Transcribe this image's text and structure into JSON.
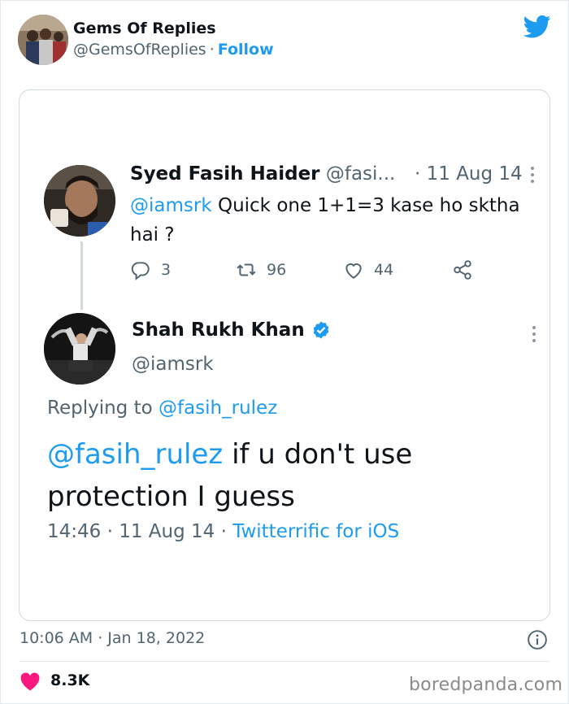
{
  "header": {
    "name": "Gems Of Replies",
    "handle": "@GemsOfReplies",
    "separator": "·",
    "follow_label": "Follow"
  },
  "reply_tweet": {
    "name": "Syed Fasih Haider",
    "handle": "@fasi...",
    "date": "· 11 Aug 14",
    "mention": "@iamsrk",
    "text": " Quick one 1+1=3 kase ho sktha hai ?",
    "replies": "3",
    "retweets": "96",
    "likes": "44"
  },
  "main_tweet": {
    "name": "Shah Rukh Khan",
    "handle": "@iamsrk",
    "replying_prefix": "Replying to ",
    "replying_handle": "@fasih_rulez",
    "mention": "@fasih_rulez",
    "text": " if u don't use protection I guess",
    "time_date": "14:46 · 11 Aug 14 · ",
    "source": "Twitterrific for iOS"
  },
  "footer": {
    "timestamp": "10:06 AM · Jan 18, 2022",
    "like_count": "8.3K",
    "watermark": "boredpanda.com"
  },
  "colors": {
    "accent": "#1d9bf0",
    "heart": "#f91880",
    "muted": "#536471"
  },
  "icons": [
    "twitter-bird-icon",
    "more-icon",
    "reply-icon",
    "retweet-icon",
    "like-icon",
    "share-icon",
    "verified-icon",
    "info-icon",
    "heart-icon"
  ]
}
